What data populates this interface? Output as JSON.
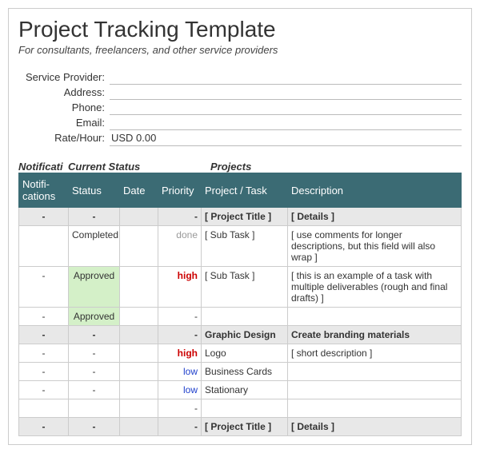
{
  "title": "Project Tracking Template",
  "subtitle": "For consultants, freelancers, and other service providers",
  "info": {
    "provider_label": "Service Provider:",
    "provider_value": "",
    "address_label": "Address:",
    "address_value": "",
    "phone_label": "Phone:",
    "phone_value": "",
    "email_label": "Email:",
    "email_value": "",
    "rate_label": "Rate/Hour:",
    "rate_value": "USD 0.00"
  },
  "section_heads": {
    "notif": "Notificati",
    "status": "Current Status",
    "projects": "Projects"
  },
  "columns": {
    "notif": "Notifi-cations",
    "status": "Status",
    "date": "Date",
    "priority": "Priority",
    "task": "Project / Task",
    "desc": "Description"
  },
  "rows": [
    {
      "type": "section",
      "notif": "-",
      "status": "-",
      "date": "",
      "priority": "-",
      "task": "[ Project Title ]",
      "desc": "[ Details ]"
    },
    {
      "type": "data",
      "notif": "",
      "status": "Completed",
      "status_class": "",
      "date": "",
      "priority": "done",
      "priority_class": "pr-done",
      "task": "[ Sub Task ]",
      "desc": "[ use comments for longer descriptions, but this field will also wrap ]"
    },
    {
      "type": "data",
      "notif": "-",
      "status": "Approved",
      "status_class": "approved",
      "date": "",
      "priority": "high",
      "priority_class": "pr-high",
      "task": "[ Sub Task ]",
      "desc": "[ this is an example of a task with multiple deliverables (rough and final drafts) ]"
    },
    {
      "type": "data",
      "notif": "-",
      "status": "Approved",
      "status_class": "approved",
      "date": "",
      "priority": "-",
      "priority_class": "",
      "task": "",
      "desc": ""
    },
    {
      "type": "section",
      "notif": "-",
      "status": "-",
      "date": "",
      "priority": "-",
      "task": "Graphic Design",
      "desc": "Create branding materials"
    },
    {
      "type": "data",
      "notif": "-",
      "status": "-",
      "status_class": "",
      "date": "",
      "priority": "high",
      "priority_class": "pr-high",
      "task": "Logo",
      "desc": "[ short description ]"
    },
    {
      "type": "data",
      "notif": "-",
      "status": "-",
      "status_class": "",
      "date": "",
      "priority": "low",
      "priority_class": "pr-low",
      "task": "Business Cards",
      "desc": ""
    },
    {
      "type": "data",
      "notif": "-",
      "status": "-",
      "status_class": "",
      "date": "",
      "priority": "low",
      "priority_class": "pr-low",
      "task": "Stationary",
      "desc": ""
    },
    {
      "type": "data",
      "notif": "",
      "status": "",
      "status_class": "",
      "date": "",
      "priority": "-",
      "priority_class": "",
      "task": "",
      "desc": ""
    },
    {
      "type": "section",
      "notif": "-",
      "status": "-",
      "date": "",
      "priority": "-",
      "task": "[ Project Title ]",
      "desc": "[ Details ]"
    }
  ]
}
